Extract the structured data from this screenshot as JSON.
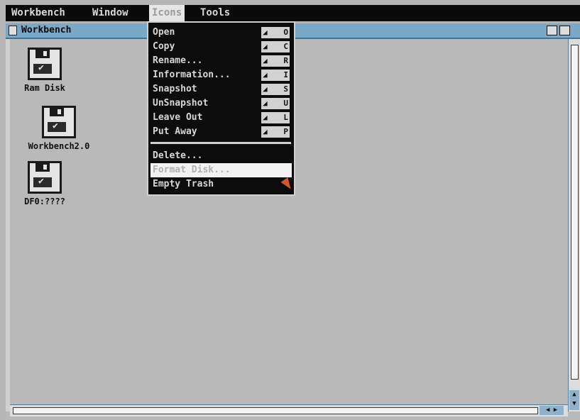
{
  "menubar": {
    "items": [
      "Workbench",
      "Window",
      "Icons",
      "Tools"
    ],
    "active_index": 2
  },
  "window": {
    "title": "Workbench"
  },
  "icons": [
    {
      "label": "Ram Disk",
      "icon": "floppy-disk-icon"
    },
    {
      "label": "Workbench2.0",
      "icon": "floppy-disk-icon"
    },
    {
      "label": "DF0:????",
      "icon": "floppy-disk-icon"
    }
  ],
  "menu": {
    "items": [
      {
        "label": "Open",
        "shortcut": "O"
      },
      {
        "label": "Copy",
        "shortcut": "C"
      },
      {
        "label": "Rename...",
        "shortcut": "R"
      },
      {
        "label": "Information...",
        "shortcut": "I"
      },
      {
        "label": "Snapshot",
        "shortcut": "S"
      },
      {
        "label": "UnSnapshot",
        "shortcut": "U"
      },
      {
        "label": "Leave Out",
        "shortcut": "L"
      },
      {
        "label": "Put Away",
        "shortcut": "P"
      }
    ],
    "extra_items": [
      {
        "label": "Delete..."
      },
      {
        "label": "Format Disk..."
      },
      {
        "label": "Empty Trash"
      }
    ],
    "highlighted": "Format Disk..."
  },
  "colors": {
    "desktop": "#b4b4b4",
    "titlebar": "#7aa8c8",
    "menu_bg": "#0c0c0c",
    "pointer": "#d5572c"
  }
}
